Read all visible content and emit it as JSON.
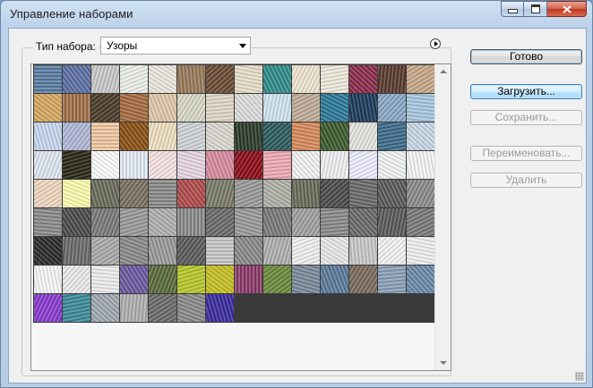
{
  "window": {
    "title": "Управление наборами"
  },
  "preset": {
    "label": "Тип набора:",
    "value": "Узоры"
  },
  "buttons": {
    "done": "Готово",
    "load": "Загрузить...",
    "save": "Сохранить...",
    "rename": "Переименовать...",
    "delete": "Удалить"
  },
  "patterns": [
    [
      "#5a7ea4",
      "#5b6fa6",
      "#c9c9c9",
      "#eef0ea",
      "#ece8de",
      "#9a7a5a",
      "#6b4a32",
      "#e8dfc8",
      "#2f8c8c",
      "#f0e6d2",
      "#f0eadc",
      "#8c2a4a",
      "#5a3a2e",
      "#c8a888"
    ],
    [
      "#d8a860",
      "#a07048",
      "#4a3a26",
      "#a66a40",
      "#e2c8a8",
      "#d8d8c8",
      "#e2d8c6",
      "#dedede",
      "#d0e6f2",
      "#c0ac98",
      "#2a7a9a",
      "#1a3a5a",
      "#8aa8c8",
      "#a8c8e0"
    ],
    [
      "#c8d8f0",
      "#b0b8d8",
      "#f0c8a0",
      "#8a5010",
      "#f0e0c0",
      "#d0d4d8",
      "#dcd8d0",
      "#2a3a2a",
      "#2a5a5a",
      "#d88a58",
      "#3a5a2a",
      "#e6e6e0",
      "#3a6a8a",
      "#c8d8e8"
    ],
    [
      "#e0e8f4",
      "#2a2414",
      "#ffffff",
      "#e4ecf6",
      "#f8e4e4",
      "#e8d8e4",
      "#d88aa0",
      "#8c0a14",
      "#f0a8b4",
      "#f4f4f4",
      "#f0f0f4",
      "#eeeeff",
      "#f2f4f4",
      "#f6f6f6"
    ],
    [
      "#f0d8c0",
      "#ffffb0",
      "#6a6a5a",
      "#7a7060",
      "#8a8a8a",
      "#b04a4a",
      "#7a7a6a",
      "#9a9a9a",
      "#b0b0a8",
      "#6a6a5a",
      "#4a4a4a",
      "#6a6a6a",
      "#5a5a5a",
      "#8a8a8a"
    ],
    [
      "#8a8a8a",
      "#4a4a4a",
      "#7a7a7a",
      "#9a9a9a",
      "#b0b0b0",
      "#8a8a8a",
      "#6a6a6a",
      "#9a9a9a",
      "#7a7a7a",
      "#a0a0a0",
      "#8a8a8a",
      "#6a6a6a",
      "#5a5a5a",
      "#7a7a7a"
    ],
    [
      "#2a2a2a",
      "#6a6a6a",
      "#aaaaaa",
      "#8a8a8a",
      "#9a9a9a",
      "#5a5a5a",
      "#c8c8c8",
      "#8a8a8a",
      "#b0b0b0",
      "#f0f0f0",
      "#e8e8e8",
      "#c8c8c8",
      "#f4f4f4",
      "#f0f0f0"
    ],
    [
      "#f8f8f8",
      "#ececec",
      "#eeeeee",
      "#6a5aa0",
      "#5a6a3a",
      "#b8c828",
      "#c8c020",
      "#8a3a6a",
      "#6a8a3a",
      "#7a8a9a",
      "#5a7a9a",
      "#7a6a5a",
      "#8aa0b8",
      "#6a8aaa"
    ],
    [
      "#8a3ad0",
      "#3a8a9a",
      "#a0a8b0",
      "#b0b0b0",
      "#6a6a6a",
      "#8a8a8a",
      "#3a2aa0"
    ]
  ]
}
